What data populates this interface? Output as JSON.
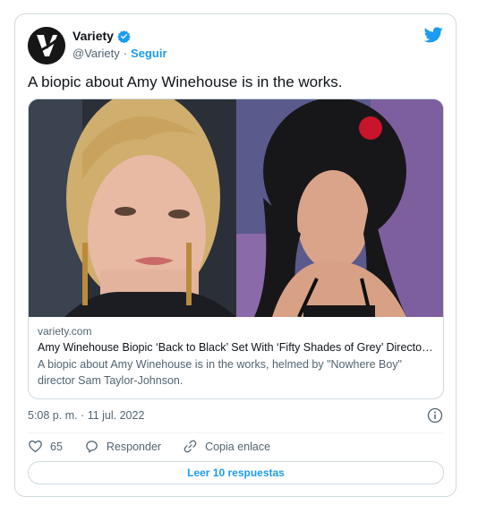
{
  "author": {
    "name": "Variety",
    "handle": "@Variety",
    "separator": "·",
    "follow_label": "Seguir",
    "avatar_letter": "V"
  },
  "tweet": {
    "text": "A biopic about Amy Winehouse is in the works."
  },
  "link_card": {
    "domain": "variety.com",
    "title": "Amy Winehouse Biopic ‘Back to Black’ Set With ‘Fifty Shades of Grey’ Director ...",
    "description": "A biopic about Amy Winehouse is in the works, helmed by \"Nowhere Boy\" director Sam Taylor-Johnson."
  },
  "meta": {
    "timestamp": "5:08 p. m. · 11 jul. 2022"
  },
  "actions": {
    "like_count": "65",
    "reply_label": "Responder",
    "copy_label": "Copia enlace"
  },
  "read_replies_label": "Leer 10 respuestas",
  "colors": {
    "accent": "#1d9bf0",
    "text": "#0f1419",
    "muted": "#536471",
    "border": "#cfd9de"
  },
  "icons": [
    "verified-icon",
    "twitter-bird-icon",
    "info-icon",
    "heart-icon",
    "reply-bubble-icon",
    "link-icon"
  ]
}
